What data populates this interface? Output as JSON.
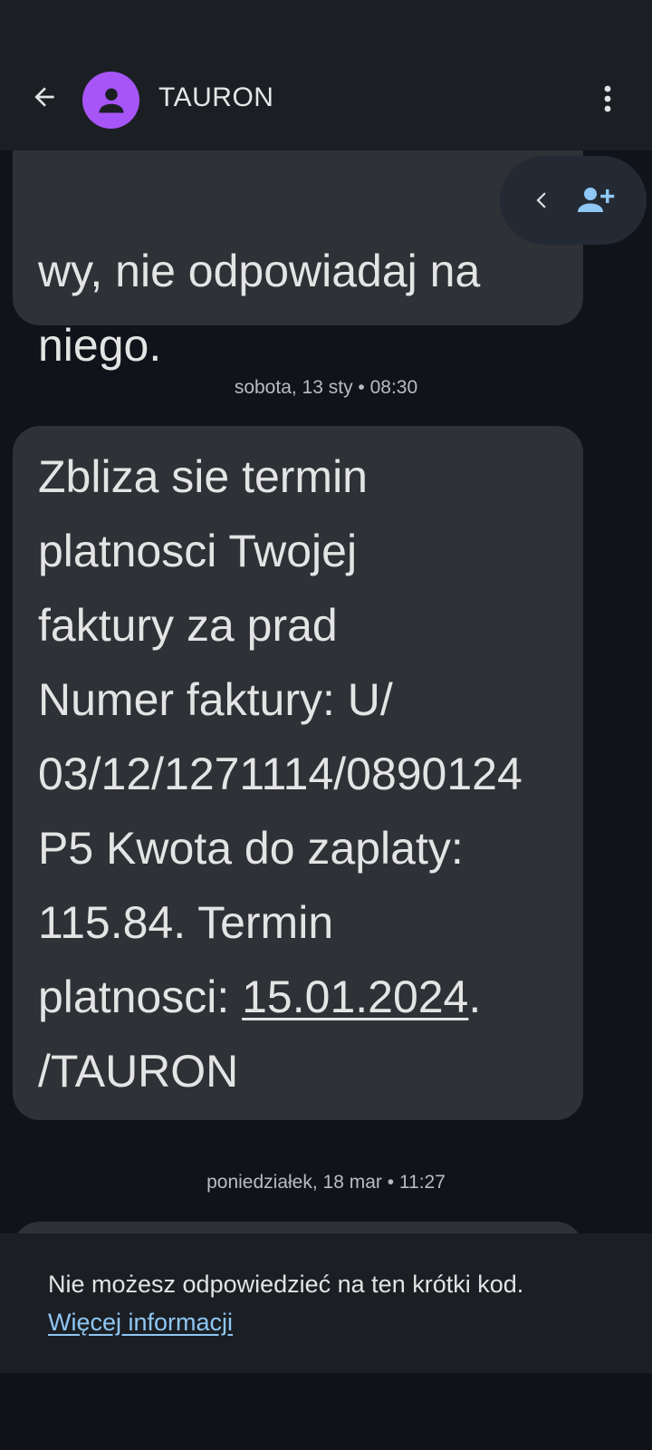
{
  "header": {
    "title": "TAURON",
    "back_icon": "arrow-back-icon",
    "avatar_icon": "person-icon",
    "more_icon": "more-vert-icon",
    "avatar_color": "#a855f7"
  },
  "messages": [
    {
      "text": "wy, nie odpowiadaj na\nniego."
    },
    {
      "timestamp": "sobota, 13 sty • 08:30",
      "text_before_date": "Zbliza sie termin\nplatnosci Twojej\nfaktury za  prad\nNumer faktury: U/\n03/12/1271114/0890124\nP5 Kwota do zaplaty:\n115.84. Termin\nplatnosci: ",
      "date_link": "15.01.2024",
      "text_after_date": ".\n/TAURON"
    },
    {
      "timestamp": "poniedziałek, 18 mar • 11:27"
    }
  ],
  "floating_actions": {
    "chevron_icon": "chevron-left-icon",
    "add_contact_icon": "person-add-icon"
  },
  "footer": {
    "notice": "Nie możesz odpowiedzieć na ten krótki kod.",
    "link": "Więcej informacji",
    "link_color": "#8fc7f5"
  }
}
